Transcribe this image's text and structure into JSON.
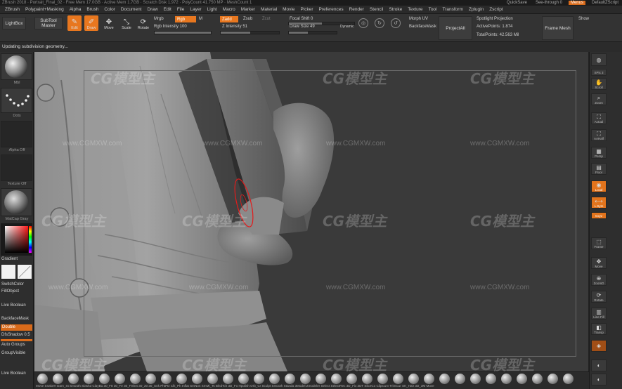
{
  "titlebar": {
    "title": "ZBrush 2018 · Portrait_Final_02 · Free Mem 17.0GB · Active Mem 1.7GB · Scratch Disk 1,972 · PolyCount 41.750 MP · MeshCount 1",
    "quicksave": "QuickSave",
    "see_through": "See-through 0",
    "menus": "Menus",
    "default_zscript": "DefaultZScript"
  },
  "menubar": [
    "Alpha",
    "Brush",
    "Color",
    "Document",
    "Draw",
    "Edit",
    "File",
    "Layer",
    "Light",
    "Macro",
    "Marker",
    "Material",
    "Movie",
    "Picker",
    "Preferences",
    "Render",
    "Stencil",
    "Stroke",
    "Texture",
    "Tool",
    "Transform",
    "Zplugin",
    "Zscript",
    "Help"
  ],
  "menubar_first": [
    "ZBrush",
    "Polypaint+Masking"
  ],
  "toolbar": {
    "lightbox": "LightBox",
    "subtool_master": "SubTool Master",
    "modes": [
      {
        "label": "Edit",
        "glyph": "✎",
        "active": true
      },
      {
        "label": "Draw",
        "glyph": "✐",
        "active": true
      },
      {
        "label": "Move",
        "glyph": "✥",
        "active": false
      },
      {
        "label": "Scale",
        "glyph": "⤡",
        "active": false
      },
      {
        "label": "Rotate",
        "glyph": "⟳",
        "active": false
      }
    ],
    "mrgb": "Mrgb",
    "rgb": "Rgb",
    "m": "M",
    "zadd": "Zadd",
    "zsub": "Zsub",
    "zcut": "Zcut",
    "rgb_intensity_label": "Rgb Intensity 100",
    "rgb_intensity_value": 100,
    "z_intensity_label": "Z Intensity 51",
    "z_intensity_value": 51,
    "focal_shift_label": "Focal Shift 0",
    "draw_size_label": "Draw Size 49",
    "dynamic": "Dynamic",
    "morph_uv": "Morph UV",
    "backface_mask": "BackfaceMask",
    "project_all": "ProjectAll",
    "spotlight_projection": "Spotlight Projection",
    "active_points": "ActivePoints: 1.874",
    "total_points": "TotalPoints: 42.563 Mil",
    "frame_mesh": "Frame Mesh",
    "show": "Show"
  },
  "status": "Updating subdivision geometry...",
  "leftbar": {
    "material_label": "Mbl",
    "stroke_label": "Dots",
    "alpha_label": "Alpha Off",
    "texture_label": "Texture Off",
    "matcap_label": "MatCap Gray",
    "gradient": "Gradient",
    "switch_color": "SwitchColor",
    "fill_object": "FillObject",
    "live_boolean": "Live Boolean",
    "backface_mask": "BackfaceMask",
    "double": "Double",
    "dlp_shadow": "DfsShadow 0.5",
    "auto_groups": "Auto Groups",
    "group_visible": "GroupVisible",
    "live_boolean_bottom": "Live Boolean"
  },
  "rightbar": {
    "items": [
      {
        "label": "",
        "glyph": "◍",
        "orange": false
      },
      {
        "label": "SPix 3",
        "glyph": "",
        "orange": false
      },
      {
        "label": "Scroll",
        "glyph": "✋",
        "orange": false
      },
      {
        "label": "Zoom",
        "glyph": "🔍",
        "orange": false
      },
      {
        "label": "Actual",
        "glyph": "⛶",
        "orange": false
      },
      {
        "label": "AAHalf",
        "glyph": "⛶",
        "orange": false
      },
      {
        "label": "Persp",
        "glyph": "▦",
        "orange": false
      },
      {
        "label": "Floor",
        "glyph": "▤",
        "orange": false
      },
      {
        "label": "Local",
        "glyph": "◉",
        "orange": true
      },
      {
        "label": "L.Sym",
        "glyph": "⟷",
        "orange": true
      },
      {
        "label": "Gxyz",
        "glyph": "",
        "orange": true
      },
      {
        "label": "Frame",
        "glyph": "⬚",
        "orange": false
      },
      {
        "label": "Move",
        "glyph": "✥",
        "orange": false
      },
      {
        "label": "ZoomD",
        "glyph": "⊕",
        "orange": false
      },
      {
        "label": "Rotate",
        "glyph": "⟳",
        "orange": false
      },
      {
        "label": "Line Fill",
        "glyph": "▥",
        "orange": false
      },
      {
        "label": "Transp",
        "glyph": "◧",
        "orange": false
      },
      {
        "label": "Solo",
        "glyph": "◈",
        "orange": false
      },
      {
        "label": "Dynamic",
        "glyph": "",
        "orange": false
      },
      {
        "label": "",
        "glyph": "◐",
        "orange": false
      }
    ]
  },
  "shelf": {
    "labels": "Move  SnakeH Dam_St Smooth  Slash3 ClayBu 30_F8 30_Fe 30_FShm 30_20 30_Snk PhtPD Clk_Ph Inflat SmNon SmMi_Ts BlndTch 3D_Fo Hpolish Orb_Cr Sculpt Smooth Standa 3Model Zmodeler Select SelectRec 3D_Fix 3DT SliceCo ClipCurv TrimCur SK_Hair 3D_3M Move"
  },
  "watermarks": {
    "logo": "CG模型主",
    "url": "www.CGMXW.com"
  }
}
